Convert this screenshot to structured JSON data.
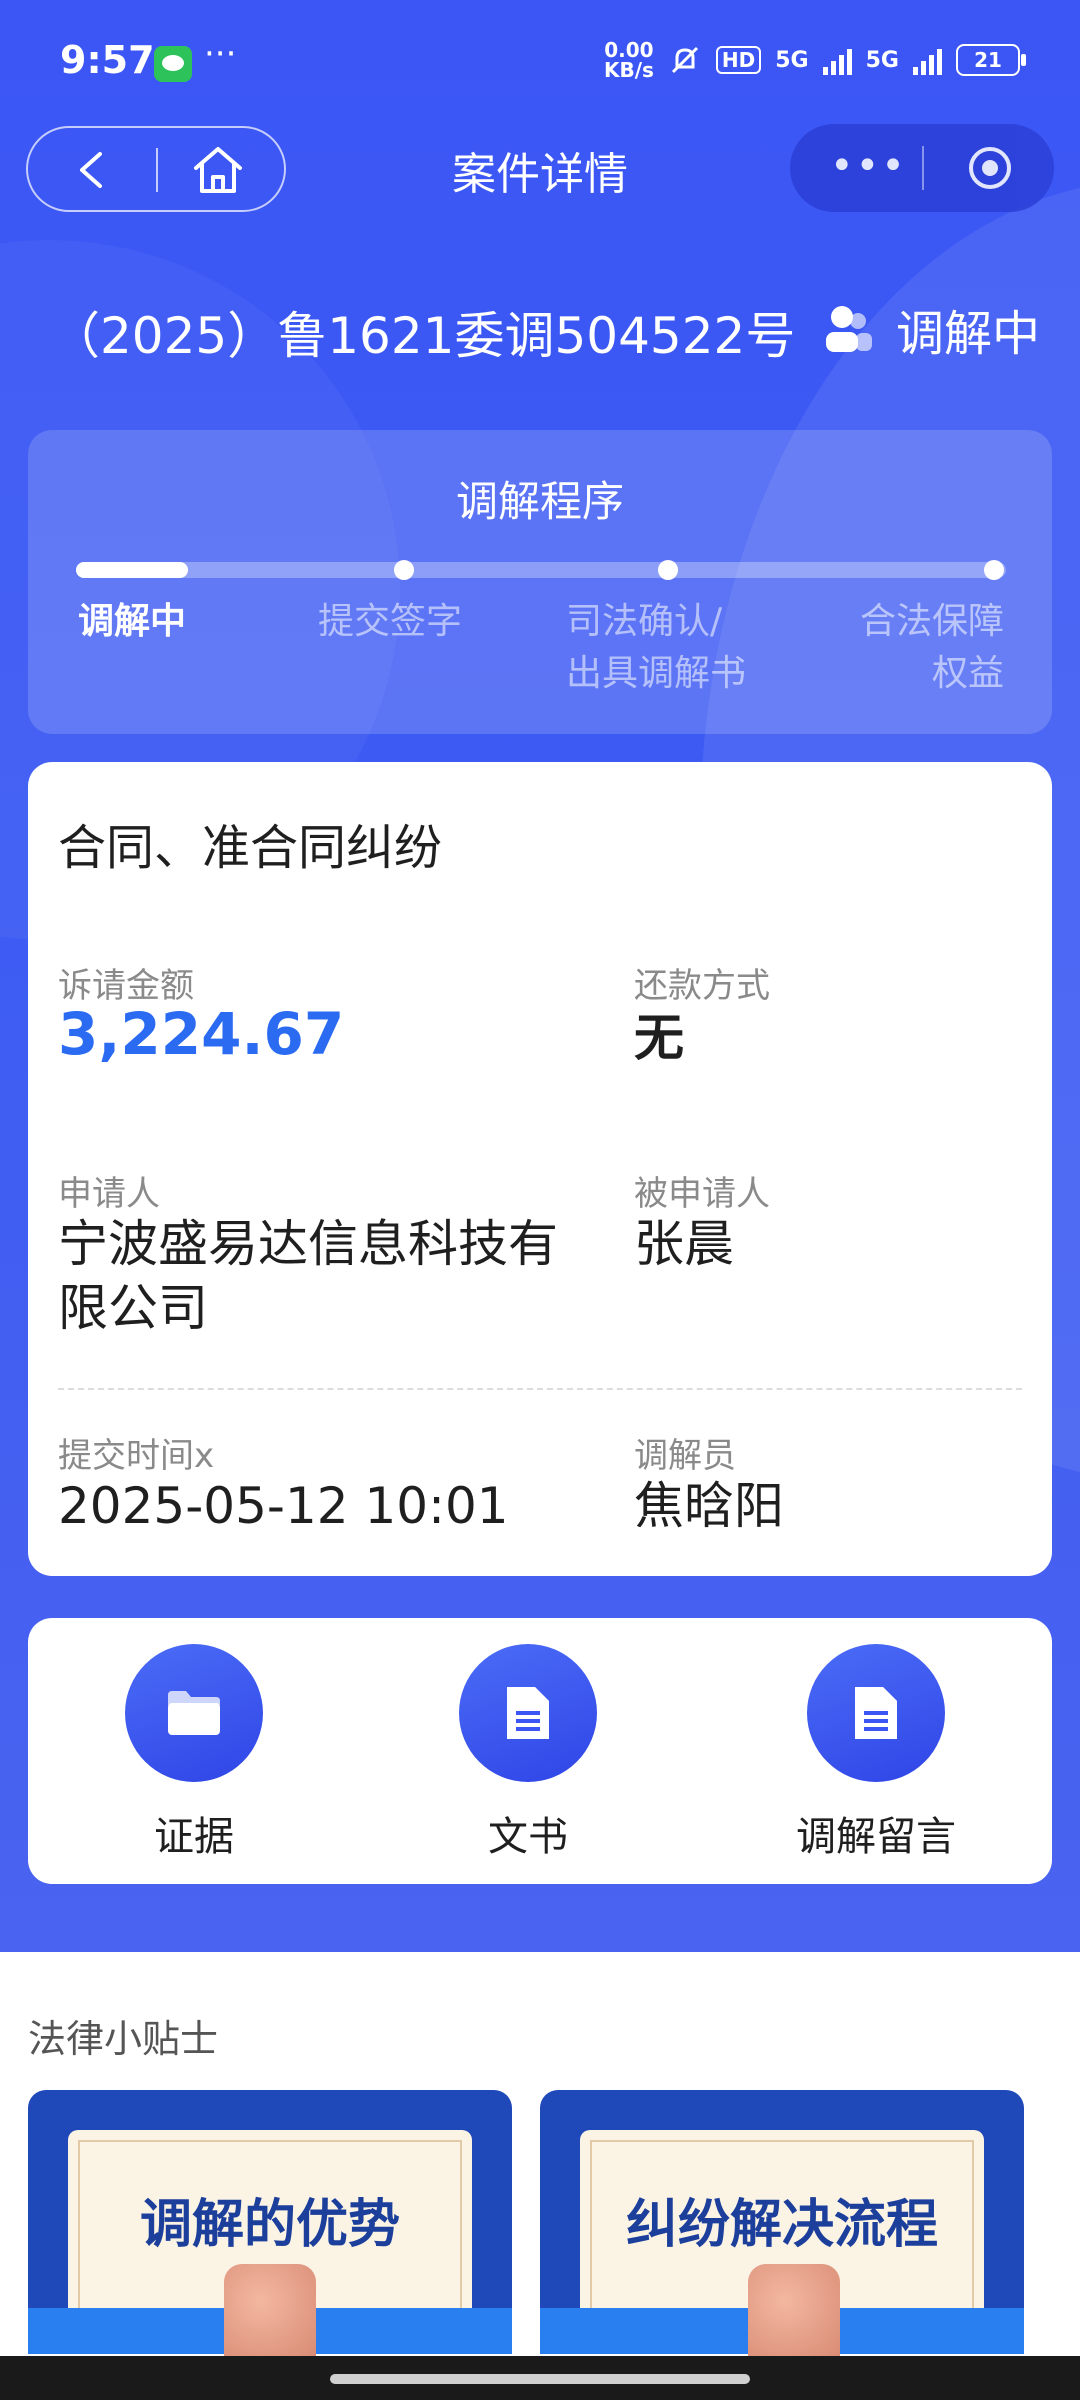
{
  "status_bar": {
    "time": "9:57",
    "dots": "···",
    "net_speed_top": "0.00",
    "net_speed_bottom": "KB/s",
    "hd_label": "HD",
    "sim1": "5G",
    "sim2": "5G",
    "battery": "21"
  },
  "nav": {
    "title": "案件详情",
    "more_glyph": "•••"
  },
  "case": {
    "number": "（2025）鲁1621委调504522号",
    "status": "调解中"
  },
  "process": {
    "title": "调解程序",
    "progress_fraction": 0.12,
    "steps": [
      {
        "line1": "调解中",
        "line2": ""
      },
      {
        "line1": "提交签字",
        "line2": ""
      },
      {
        "line1": "司法确认/",
        "line2": "出具调解书"
      },
      {
        "line1": "合法保障",
        "line2": "权益"
      }
    ]
  },
  "info": {
    "dispute_type": "合同、准合同纠纷",
    "claim_amount_label": "诉请金额",
    "claim_amount": "3,224.67",
    "repayment_label": "还款方式",
    "repayment": "无",
    "applicant_label": "申请人",
    "applicant_line1": "宁波盛易达信息科技有",
    "applicant_line2": "限公司",
    "respondent_label": "被申请人",
    "respondent": "张晨",
    "submit_time_label": "提交时间x",
    "submit_time": "2025-05-12 10:01",
    "mediator_label": "调解员",
    "mediator": "焦晗阳"
  },
  "actions": [
    {
      "label": "证据",
      "icon": "folder-icon"
    },
    {
      "label": "文书",
      "icon": "document-icon"
    },
    {
      "label": "调解留言",
      "icon": "document-icon"
    }
  ],
  "tips": {
    "title": "法律小贴士",
    "cards": [
      "调解的优势",
      "纠纷解决流程"
    ]
  },
  "colors": {
    "primary": "#3b56f5",
    "amount": "#2a6bf2"
  }
}
